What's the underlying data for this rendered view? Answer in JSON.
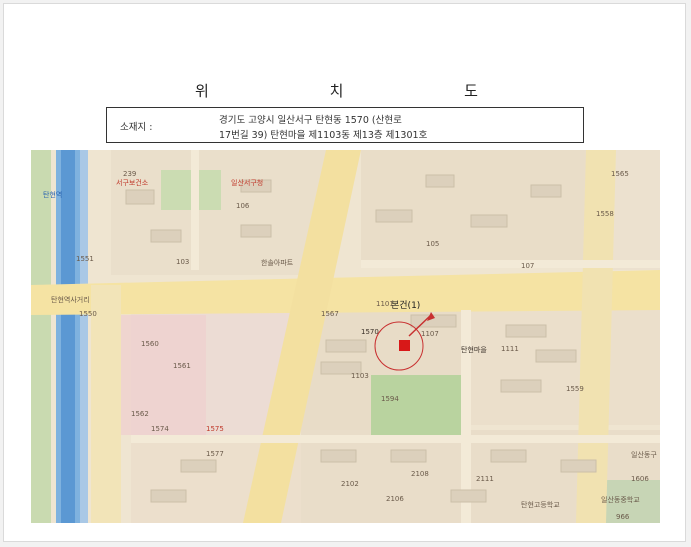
{
  "document": {
    "title": "위 치 도",
    "address_label": "소재지 :",
    "address_line1": "경기도 고양시 일산서구 탄현동 1570 (산현로",
    "address_line2": "17번길 39) 탄현마을 제1103동 제13층 제1301호"
  },
  "map": {
    "subject_label": "본건(1)",
    "marker_color": "#d81818",
    "place_labels": [
      {
        "text": "탄현역",
        "cls": "blue"
      },
      {
        "text": "서구보건소",
        "cls": "red"
      },
      {
        "text": "일산서구청",
        "cls": "red"
      },
      {
        "text": "탄현마을",
        "cls": "dark"
      },
      {
        "text": "한솔아파트",
        "cls": ""
      },
      {
        "text": "1570",
        "cls": "dark"
      },
      {
        "text": "1561",
        "cls": ""
      },
      {
        "text": "1562",
        "cls": ""
      },
      {
        "text": "1560",
        "cls": ""
      },
      {
        "text": "1574",
        "cls": ""
      },
      {
        "text": "1575",
        "cls": "red"
      },
      {
        "text": "1577",
        "cls": ""
      },
      {
        "text": "1559",
        "cls": ""
      },
      {
        "text": "1551",
        "cls": ""
      },
      {
        "text": "1558",
        "cls": ""
      },
      {
        "text": "1567",
        "cls": ""
      },
      {
        "text": "1550",
        "cls": ""
      },
      {
        "text": "1606",
        "cls": ""
      },
      {
        "text": "1565",
        "cls": ""
      },
      {
        "text": "1594",
        "cls": ""
      },
      {
        "text": "106",
        "cls": ""
      },
      {
        "text": "103",
        "cls": ""
      },
      {
        "text": "107",
        "cls": ""
      },
      {
        "text": "105",
        "cls": ""
      },
      {
        "text": "1101",
        "cls": ""
      },
      {
        "text": "1103",
        "cls": ""
      },
      {
        "text": "1107",
        "cls": ""
      },
      {
        "text": "1111",
        "cls": ""
      },
      {
        "text": "2102",
        "cls": ""
      },
      {
        "text": "2106",
        "cls": ""
      },
      {
        "text": "2108",
        "cls": ""
      },
      {
        "text": "2111",
        "cls": ""
      },
      {
        "text": "239",
        "cls": ""
      },
      {
        "text": "966",
        "cls": ""
      },
      {
        "text": "탄현역사거리",
        "cls": ""
      },
      {
        "text": "탄현고등학교",
        "cls": ""
      },
      {
        "text": "일산동중학교",
        "cls": ""
      },
      {
        "text": "일산동구",
        "cls": ""
      }
    ]
  }
}
